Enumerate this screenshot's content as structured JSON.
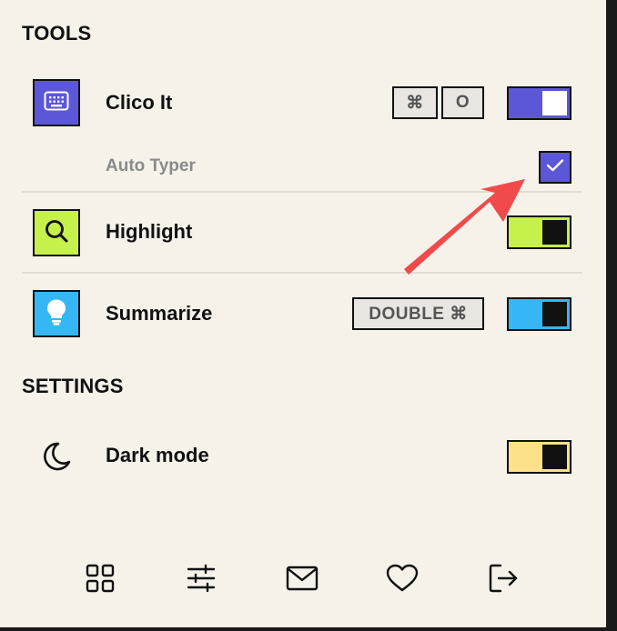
{
  "tools": {
    "title": "TOOLS",
    "clico": {
      "label": "Clico It",
      "icon": "keyboard-icon",
      "icon_bg": "#5b57d6",
      "shortcut_keys": [
        "⌘",
        "O"
      ],
      "enabled": true,
      "toggle_color": "#5b57d6",
      "auto_typer": {
        "label": "Auto Typer",
        "checked": true
      }
    },
    "highlight": {
      "label": "Highlight",
      "icon": "search-icon",
      "icon_bg": "#c6f04a",
      "enabled": true,
      "toggle_color": "#c6f04a"
    },
    "summarize": {
      "label": "Summarize",
      "icon": "lightbulb-icon",
      "icon_bg": "#36b6f5",
      "shortcut": "DOUBLE ⌘",
      "enabled": true,
      "toggle_color": "#36b6f5"
    }
  },
  "settings": {
    "title": "SETTINGS",
    "dark_mode": {
      "label": "Dark mode",
      "icon": "moon-icon",
      "enabled": true,
      "toggle_color": "#fde08a"
    }
  },
  "bottom_nav": {
    "items": [
      {
        "icon": "grid-icon"
      },
      {
        "icon": "sliders-icon"
      },
      {
        "icon": "mail-icon"
      },
      {
        "icon": "heart-icon"
      },
      {
        "icon": "logout-icon"
      }
    ]
  },
  "annotation": {
    "arrow_color": "#f04a4a",
    "points_to": "auto-typer-checkbox"
  }
}
